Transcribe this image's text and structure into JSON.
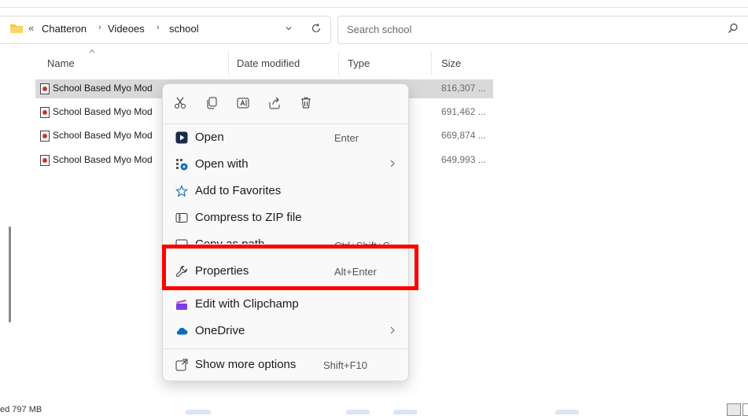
{
  "address": {
    "overflow_glyph": "«",
    "crumbs": [
      "Chatteron",
      "Videoes",
      "school"
    ],
    "separator": "›"
  },
  "search": {
    "placeholder": "Search school"
  },
  "columns": {
    "name": "Name",
    "date": "Date modified",
    "type": "Type",
    "size": "Size"
  },
  "files": [
    {
      "name": "School Based Myo Mod",
      "size": "816,307 ..."
    },
    {
      "name": "School Based Myo Mod",
      "size": "691,462 ..."
    },
    {
      "name": "School Based Myo Mod",
      "size": "669,874 ..."
    },
    {
      "name": "School Based Myo Mod",
      "size": "649,993 ..."
    }
  ],
  "status": {
    "text": "ed 797 MB"
  },
  "context_menu": {
    "quick_actions": [
      "cut-icon",
      "copy-icon",
      "rename-icon",
      "share-icon",
      "delete-icon"
    ],
    "items": [
      {
        "label": "Open",
        "shortcut": "Enter",
        "icon": "media-player-icon"
      },
      {
        "label": "Open with",
        "shortcut": "",
        "icon": "open-with-icon",
        "submenu": "›"
      },
      {
        "label": "Add to Favorites",
        "shortcut": "",
        "icon": "star-icon"
      },
      {
        "label": "Compress to ZIP file",
        "shortcut": "",
        "icon": "zip-icon"
      },
      {
        "label": "Copy as path",
        "shortcut": "Ctrl+Shift+C",
        "icon": "copy-path-icon"
      },
      {
        "label": "Properties",
        "shortcut": "Alt+Enter",
        "icon": "wrench-icon"
      },
      {
        "label": "Edit with Clipchamp",
        "shortcut": "",
        "icon": "clipchamp-icon"
      },
      {
        "label": "OneDrive",
        "shortcut": "",
        "icon": "cloud-icon",
        "submenu": "›"
      },
      {
        "label": "Show more options",
        "shortcut": "Shift+F10",
        "icon": "more-options-icon"
      }
    ]
  },
  "colors": {
    "highlight": "#ff0000",
    "folder": "#f4c542",
    "onedrive": "#0f6cbd",
    "clipchamp": "#7b3fe4"
  }
}
